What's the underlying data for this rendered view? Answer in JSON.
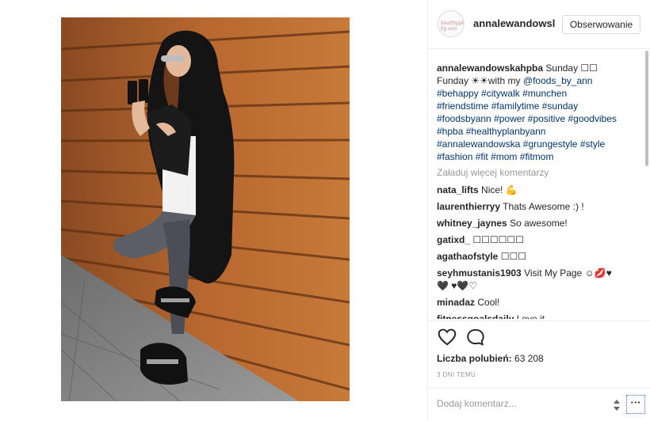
{
  "post": {
    "username": "annalewandowsl",
    "follow_label": "Obserwowanie",
    "avatar_text": "healthyplan by ann"
  },
  "caption": {
    "username": "annalewandowskahpba",
    "text_1": "Sunday ☐☐",
    "text_2": "Funday ☀☀with my",
    "mention": "@foods_by_ann",
    "tags": [
      "#behappy",
      "#citywalk",
      "#munchen",
      "#friendstime",
      "#familytime",
      "#sunday",
      "#foodsbyann",
      "#power",
      "#positive",
      "#goodvibes",
      "#hpba",
      "#healthyplanbyann",
      "#annalewandowska",
      "#grungestyle",
      "#style",
      "#fashion",
      "#fit",
      "#mom",
      "#fitmom"
    ]
  },
  "load_more_label": "Załaduj więcej komentarzy",
  "comments": [
    {
      "user": "nata_lifts",
      "text": "Nice! 💪"
    },
    {
      "user": "laurenthierryy",
      "text": "Thats Awesome :) !"
    },
    {
      "user": "whitney_jaynes",
      "text": "So awesome!"
    },
    {
      "user": "gatixd_",
      "text": "☐☐☐☐☐☐"
    },
    {
      "user": "agathaofstyle",
      "text": "☐☐☐"
    },
    {
      "user": "seyhmustanis1903",
      "text": "Visit My Page ☺💋♥🖤 ♥🖤♡"
    },
    {
      "user": "minadaz",
      "text": "Cool!"
    },
    {
      "user": "fitnessgoalsdaily",
      "text": "Love it"
    }
  ],
  "actions": {
    "like_icon": "heart-icon",
    "comment_icon": "speech-bubble-icon"
  },
  "likes": {
    "label": "Liczba polubień:",
    "count": "63 208"
  },
  "time_ago": "3 DNI TEMU",
  "add_comment_placeholder": "Dodaj komentarz...",
  "more_label": "···"
}
